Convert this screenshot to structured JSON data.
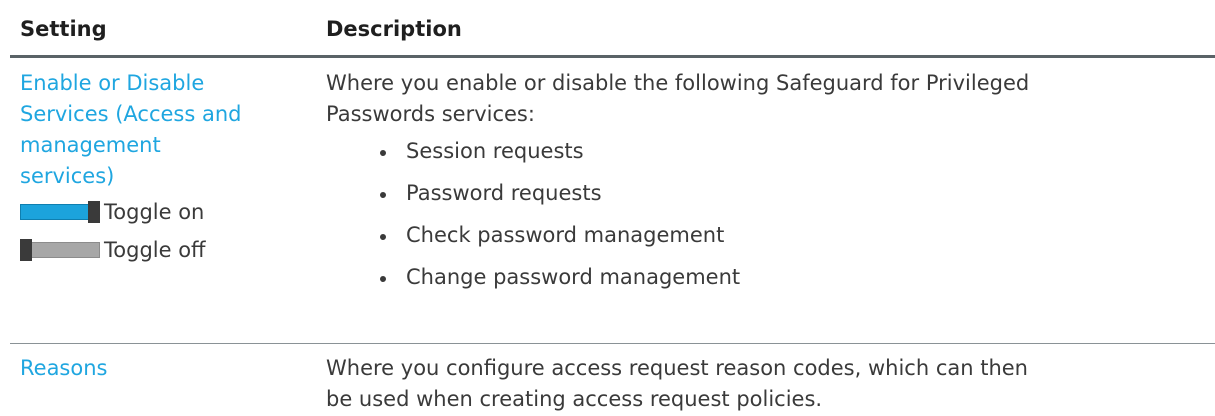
{
  "table": {
    "headers": {
      "setting": "Setting",
      "description": "Description"
    },
    "rows": [
      {
        "setting": "Enable or Disable Services (Access and management services)",
        "setting_lines": [
          "Enable or Disable",
          "Services (Access and",
          "management",
          "services)"
        ],
        "toggle_on_label": "Toggle on",
        "toggle_off_label": "Toggle off",
        "description": "Where you enable or disable the following Safeguard for Privileged Passwords services:",
        "description_lines": [
          "Where you enable or disable the following Safeguard for Privileged",
          "Passwords services:"
        ],
        "bullets": [
          "Session requests",
          "Password requests",
          "Check password management",
          "Change password management"
        ]
      },
      {
        "setting": "Reasons",
        "description": "Where you configure access request reason codes, which can then be used when creating access request policies.",
        "description_lines": [
          "Where you configure access request reason codes, which can then",
          "be used when creating access request policies."
        ]
      }
    ]
  },
  "colors": {
    "link": "#1fa6e0",
    "toggle_on": "#1ca3dc",
    "toggle_off": "#a7a7a7",
    "header_rule": "#5a6367"
  }
}
